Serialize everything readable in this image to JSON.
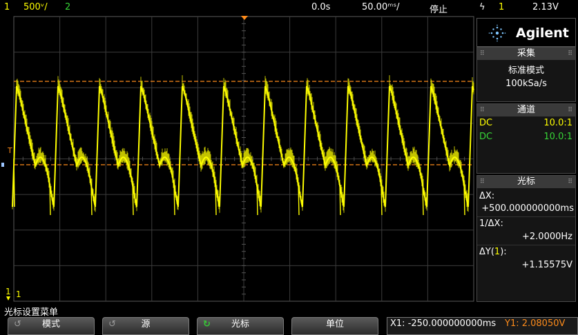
{
  "top_bar": {
    "channel_num": "1",
    "volts_per_div": "500ᵛ/",
    "channel2_num": "2",
    "time_offset": "0.0s",
    "time_per_div": "50.00ᵐˢ/",
    "run_state": "停止",
    "trigger_slope": "ϟ",
    "trigger_channel": "1",
    "trigger_level": "2.13V"
  },
  "scope": {
    "trigger_marker": "T",
    "channel_marker": "1",
    "ground_marker": "1"
  },
  "panel": {
    "brand": "Agilent",
    "acquire": {
      "title": "采集",
      "mode": "标准模式",
      "rate": "100kSa/s"
    },
    "channels": {
      "title": "通道",
      "rows": [
        {
          "coupling": "DC",
          "probe": "10.0:1",
          "color": "#ffff00"
        },
        {
          "coupling": "DC",
          "probe": "10.0:1",
          "color": "#37d637"
        }
      ]
    },
    "cursors": {
      "title": "光标",
      "dx_label": "ΔX:",
      "dx_value": "+500.000000000ms",
      "inv_dx_label": "1/ΔX:",
      "inv_dx_value": "+2.0000Hz",
      "dy_label_pre": "ΔY(",
      "dy_label_ch": "1",
      "dy_label_post": "):",
      "dy_value": "+1.15575V"
    }
  },
  "bottom": {
    "menu_title": "光标设置菜单",
    "softkeys": [
      {
        "label": "模式",
        "icon": "↺"
      },
      {
        "label": "源",
        "icon": "↺"
      },
      {
        "label": "光标",
        "icon": "↻"
      },
      {
        "label": "单位",
        "icon": ""
      }
    ],
    "readout": {
      "x1": "X1: -250.000000000ms",
      "y1": "Y1: 2.08050V"
    }
  },
  "colors": {
    "ch1": "#ffff00",
    "ch2": "#37d637",
    "cursor_orange": "#ff8c1a",
    "grid": "#3c3c3c"
  }
}
